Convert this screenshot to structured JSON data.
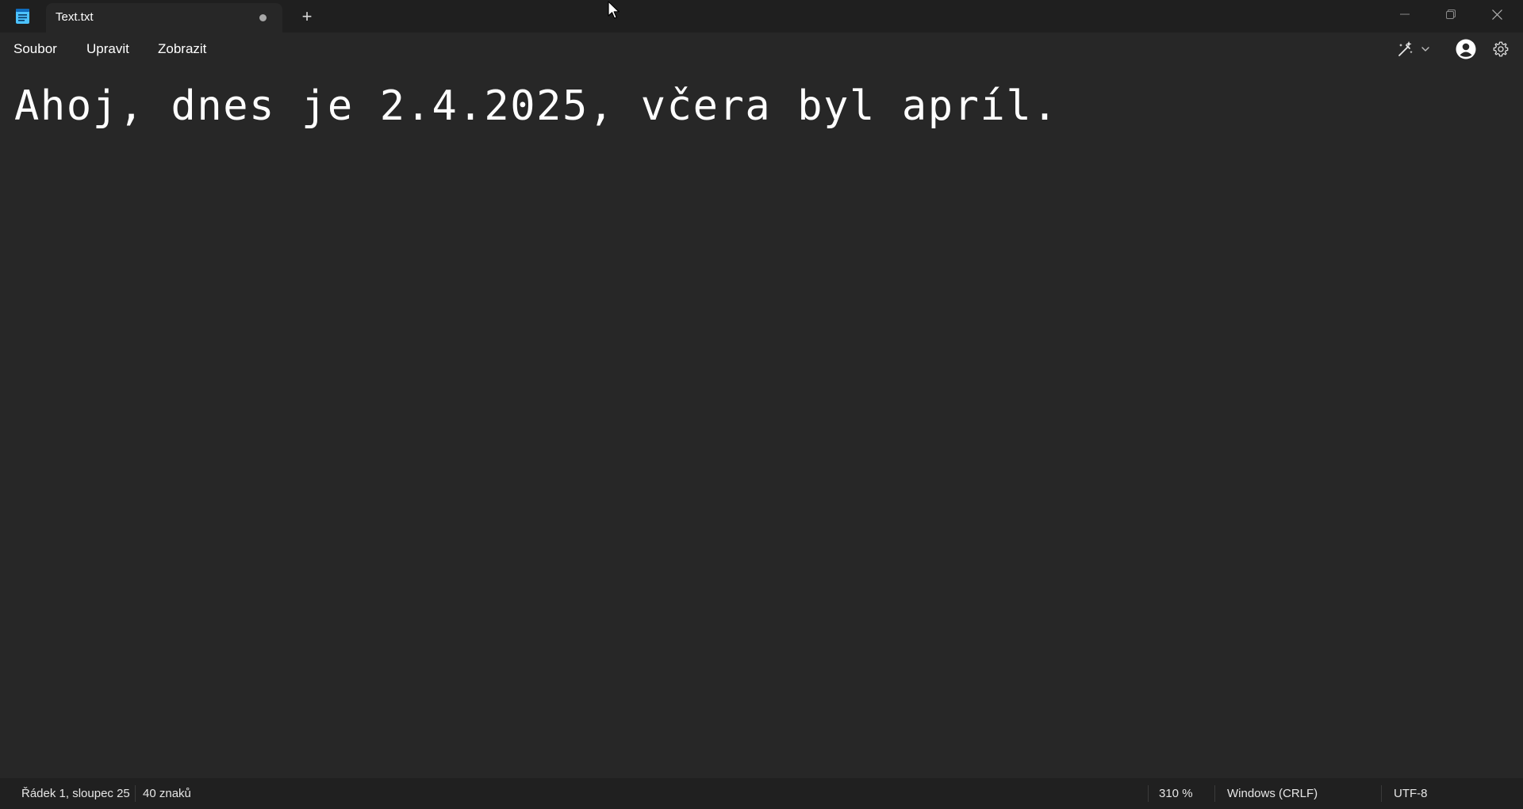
{
  "window": {
    "tab_title": "Text.txt",
    "new_tab_symbol": "+",
    "controls": [
      "minimize-icon",
      "restore-icon",
      "close-icon"
    ]
  },
  "menu": {
    "file": "Soubor",
    "edit": "Upravit",
    "view": "Zobrazit"
  },
  "toolbar_icons": [
    "copilot-icon",
    "chevron-down-icon",
    "account-icon",
    "gear-icon"
  ],
  "editor": {
    "content": "Ahoj, dnes je 2.4.2025, včera byl apríl."
  },
  "status": {
    "position": "Řádek 1, sloupec 25",
    "char_count": "40 znaků",
    "zoom": "310 %",
    "line_ending": "Windows (CRLF)",
    "encoding": "UTF-8"
  },
  "colors": {
    "background": "#272727",
    "titlebar": "#1f1f1f",
    "statusbar": "#202020",
    "app_icon_accent": "#4cc2ff",
    "text": "#ffffff"
  }
}
